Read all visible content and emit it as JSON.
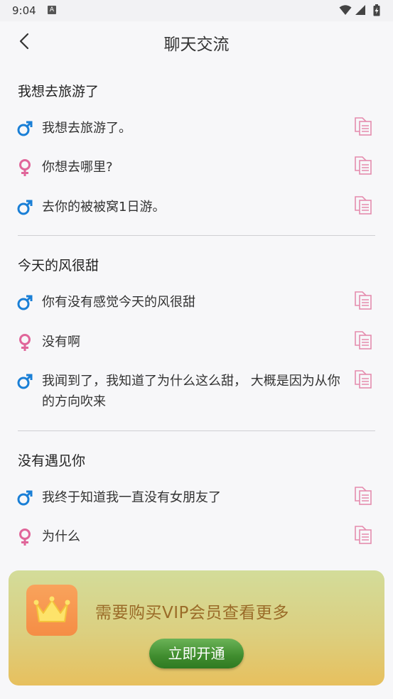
{
  "status_bar": {
    "time": "9:04",
    "notif_letter": "A"
  },
  "header": {
    "title": "聊天交流",
    "back_icon": "chevron-left-icon"
  },
  "sections": [
    {
      "title": "我想去旅游了",
      "messages": [
        {
          "gender": "male",
          "text": "我想去旅游了。"
        },
        {
          "gender": "female",
          "text": "你想去哪里?"
        },
        {
          "gender": "male",
          "text": "去你的被被窝1日游。"
        }
      ]
    },
    {
      "title": "今天的风很甜",
      "messages": [
        {
          "gender": "male",
          "text": "你有没有感觉今天的风很甜"
        },
        {
          "gender": "female",
          "text": "没有啊"
        },
        {
          "gender": "male",
          "text": "我闻到了，我知道了为什么这么甜， 大概是因为从你的方向吹来"
        }
      ]
    },
    {
      "title": "没有遇见你",
      "messages": [
        {
          "gender": "male",
          "text": "我终于知道我一直没有女朋友了"
        },
        {
          "gender": "female",
          "text": "为什么"
        }
      ]
    }
  ],
  "vip": {
    "text": "需要购买VIP会员查看更多",
    "button_label": "立即开通",
    "icon": "crown-icon"
  },
  "colors": {
    "male": "#1a7fd6",
    "female": "#e0669a",
    "copy": "#e58cae",
    "vip_text": "#9a6b28"
  }
}
